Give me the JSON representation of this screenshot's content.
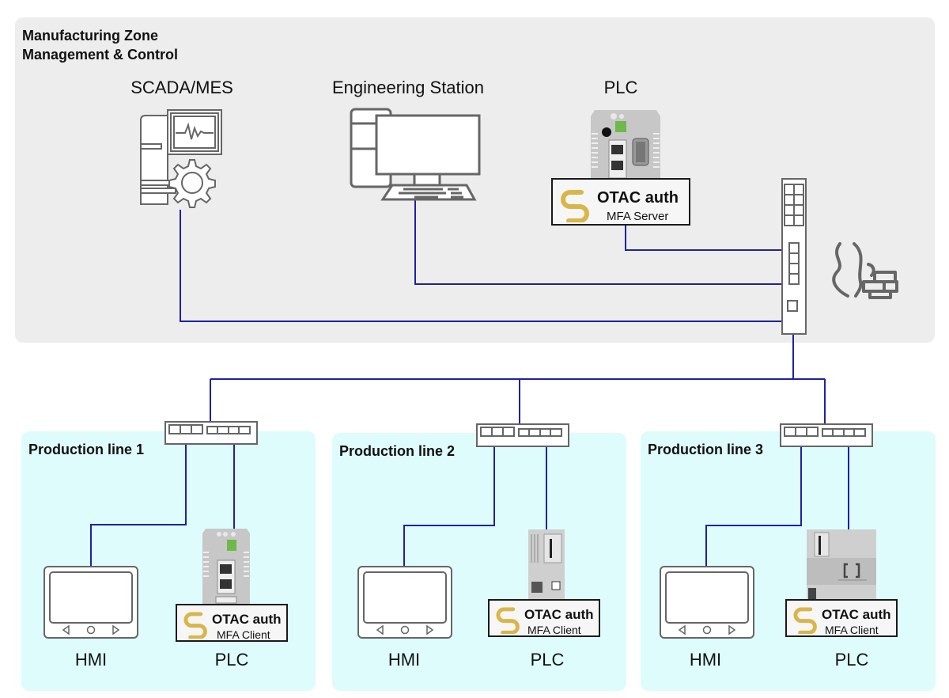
{
  "zone": {
    "title_line1": "Manufacturing Zone",
    "title_line2": "Management & Control"
  },
  "devices": {
    "scada": "SCADA/MES",
    "engineering": "Engineering Station",
    "plc": "PLC"
  },
  "otac": {
    "brand": "OTAC auth",
    "server_role": "MFA Server",
    "client_role": "MFA Client",
    "logo_color": "#d9b64a"
  },
  "production_lines": [
    {
      "title": "Production line 1",
      "hmi": "HMI",
      "plc": "PLC"
    },
    {
      "title": "Production line 2",
      "hmi": "HMI",
      "plc": "PLC"
    },
    {
      "title": "Production line 3",
      "hmi": "HMI",
      "plc": "PLC"
    }
  ],
  "colors": {
    "wire": "#1e22a0",
    "zone_bg": "#ededed",
    "line_bg": "#dffcfc",
    "icon_stroke": "#666666"
  }
}
